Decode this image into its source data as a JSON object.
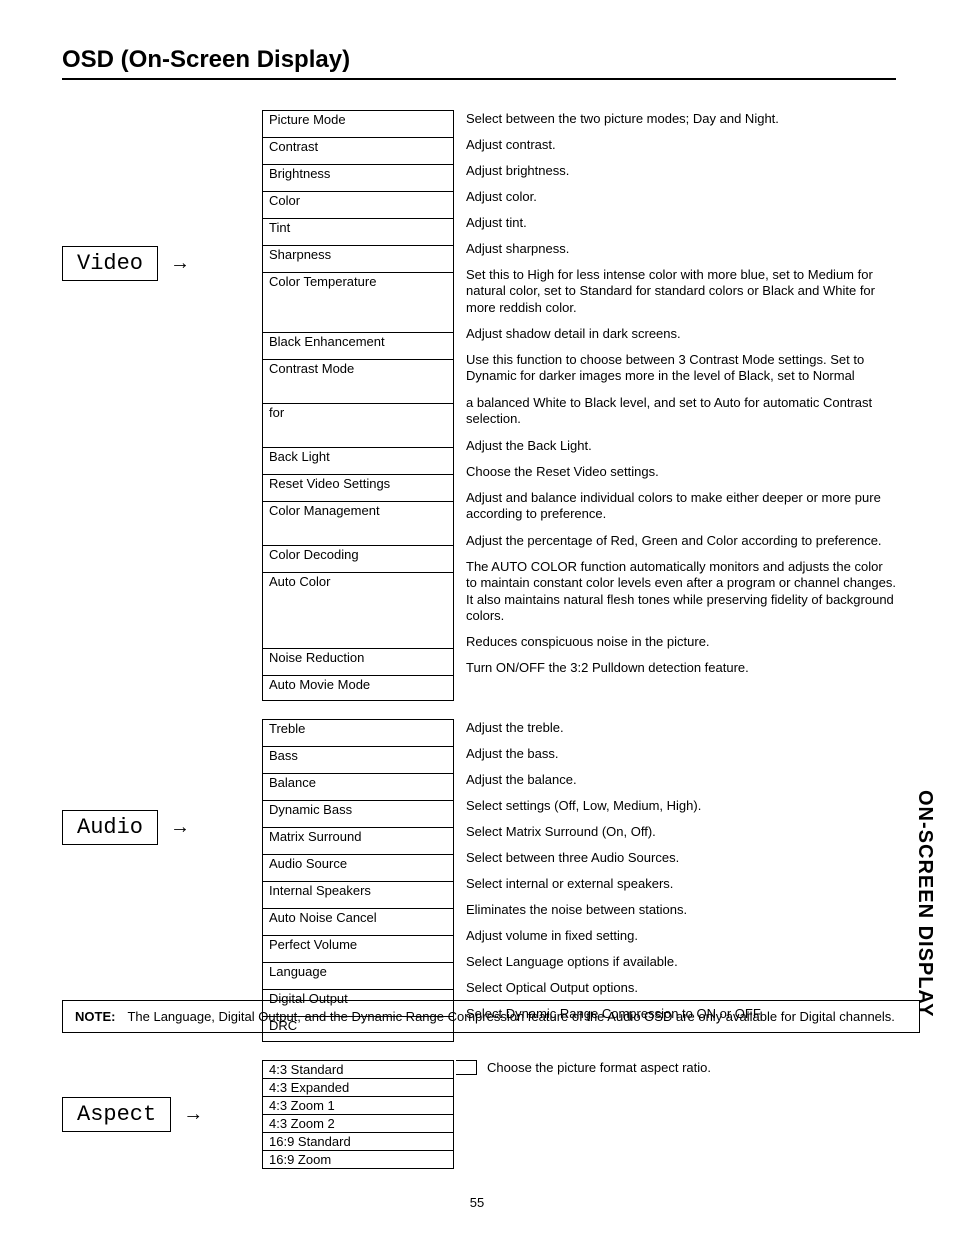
{
  "title": "OSD (On-Screen Display)",
  "side_label": "ON-SCREEN DISPLAY",
  "page_number": "55",
  "note_label": "NOTE:",
  "note_text": "The Language, Digital Output, and the Dynamic Range Compression feature of the Audio OSD are only available for Digital channels.",
  "sections": {
    "video": {
      "label": "Video",
      "aspect_mode": false,
      "items": [
        {
          "setting": "Picture Mode",
          "desc": "Select between the two picture modes; Day and Night."
        },
        {
          "setting": "Contrast",
          "desc": "Adjust contrast."
        },
        {
          "setting": "Brightness",
          "desc": "Adjust brightness."
        },
        {
          "setting": "Color",
          "desc": "Adjust color."
        },
        {
          "setting": "Tint",
          "desc": "Adjust tint."
        },
        {
          "setting": "Sharpness",
          "desc": "Adjust sharpness."
        },
        {
          "setting": "Color Temperature",
          "desc": "Set this to High for less intense color with more blue, set to Medium for natural color, set to Standard for standard colors or Black and White for more reddish color."
        },
        {
          "setting": "Black Enhancement",
          "desc": "Adjust shadow detail in dark screens."
        },
        {
          "setting": "Contrast Mode",
          "desc": "Use this function to choose between 3 Contrast Mode settings.  Set to Dynamic for darker images more in the level of Black, set to Normal"
        },
        {
          "setting": "for",
          "desc": "a balanced White to Black level, and set to Auto for automatic Contrast selection."
        },
        {
          "setting": "Back Light",
          "desc": "Adjust the Back Light."
        },
        {
          "setting": "Reset Video Settings",
          "desc": "Choose the Reset Video settings."
        },
        {
          "setting": "Color Management",
          "desc": "Adjust and balance individual colors to make either deeper or more pure according to preference."
        },
        {
          "setting": "Color Decoding",
          "desc": "Adjust the percentage of Red, Green and Color according to preference."
        },
        {
          "setting": "Auto Color",
          "desc": "The AUTO COLOR function automatically monitors and adjusts the color to maintain constant color levels even after a program or channel changes. It also maintains natural flesh tones while preserving fidelity of background colors."
        },
        {
          "setting": "Noise Reduction",
          "desc": "Reduces conspicuous noise in the picture."
        },
        {
          "setting": "Auto Movie Mode",
          "desc": "Turn ON/OFF the 3:2 Pulldown detection feature."
        }
      ]
    },
    "audio": {
      "label": "Audio",
      "aspect_mode": false,
      "items": [
        {
          "setting": "Treble",
          "desc": "Adjust the treble."
        },
        {
          "setting": "Bass",
          "desc": "Adjust the bass."
        },
        {
          "setting": "Balance",
          "desc": "Adjust the balance."
        },
        {
          "setting": "Dynamic Bass",
          "desc": "Select settings (Off, Low, Medium, High)."
        },
        {
          "setting": "Matrix Surround",
          "desc": "Select Matrix Surround (On, Off)."
        },
        {
          "setting": "Audio Source",
          "desc": "Select between three Audio Sources."
        },
        {
          "setting": "Internal Speakers",
          "desc": "Select internal or external speakers."
        },
        {
          "setting": "Auto Noise Cancel",
          "desc": "Eliminates the noise between stations."
        },
        {
          "setting": "Perfect Volume",
          "desc": "Adjust volume in fixed setting."
        },
        {
          "setting": "Language",
          "desc": "Select Language options if available."
        },
        {
          "setting": "Digital Output",
          "desc": "Select Optical Output options."
        },
        {
          "setting": "DRC",
          "desc": "Select Dynamic Range Compression to ON or OFF."
        }
      ]
    },
    "aspect": {
      "label": "Aspect",
      "aspect_mode": true,
      "shared_desc": "Choose the picture format aspect ratio.",
      "items": [
        {
          "setting": "4:3 Standard"
        },
        {
          "setting": "4:3 Expanded"
        },
        {
          "setting": "4:3 Zoom 1"
        },
        {
          "setting": "4:3 Zoom 2"
        },
        {
          "setting": "16:9 Standard"
        },
        {
          "setting": "16:9 Zoom"
        }
      ]
    }
  }
}
